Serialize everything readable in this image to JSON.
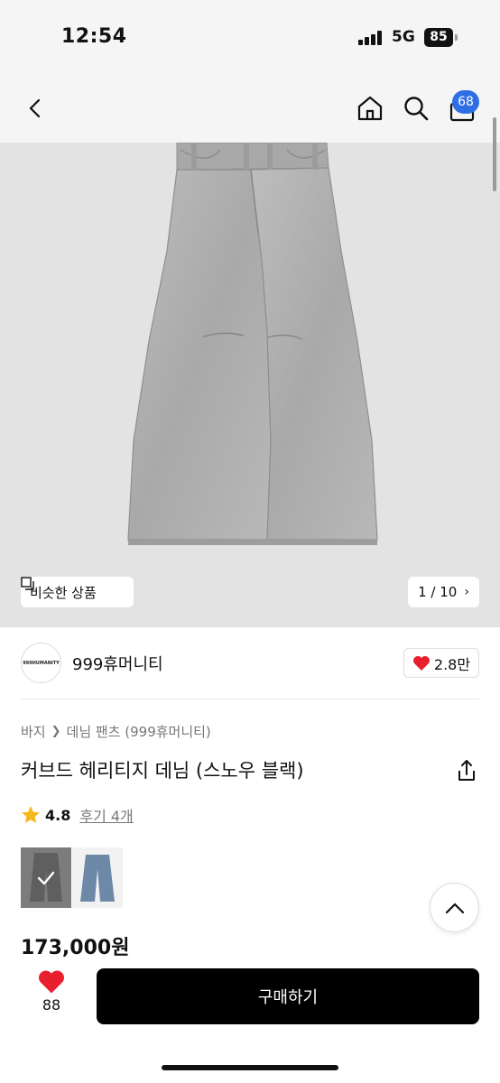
{
  "status_bar": {
    "time": "12:54",
    "network": "5G",
    "battery": "85"
  },
  "nav": {
    "cart_count": "68",
    "back_icon": "chevron-left-icon",
    "home_icon": "home-icon",
    "search_icon": "search-icon",
    "cart_icon": "shopping-bag-icon"
  },
  "hero": {
    "similar_label": "비슷한 상품",
    "page_indicator": "1 / 10",
    "image_alt": "jeans-photo"
  },
  "brand": {
    "logo_text": "999HUMANITY",
    "name": "999휴머니티",
    "likes": "2.8만"
  },
  "product": {
    "breadcrumb": [
      "바지",
      "데님 팬츠 (999휴머니티)"
    ],
    "title": "커브드 헤리티지 데님 (스노우 블랙)",
    "rating": "4.8",
    "review_label": "후기 4개",
    "price": "173,000원"
  },
  "bottom": {
    "like_count": "88",
    "buy_label": "구매하기"
  },
  "colors": {
    "accent_blue": "#2f6fe4",
    "heart_red": "#e8202e",
    "star_yellow": "#f5b71e",
    "buy_bg": "#000000"
  }
}
